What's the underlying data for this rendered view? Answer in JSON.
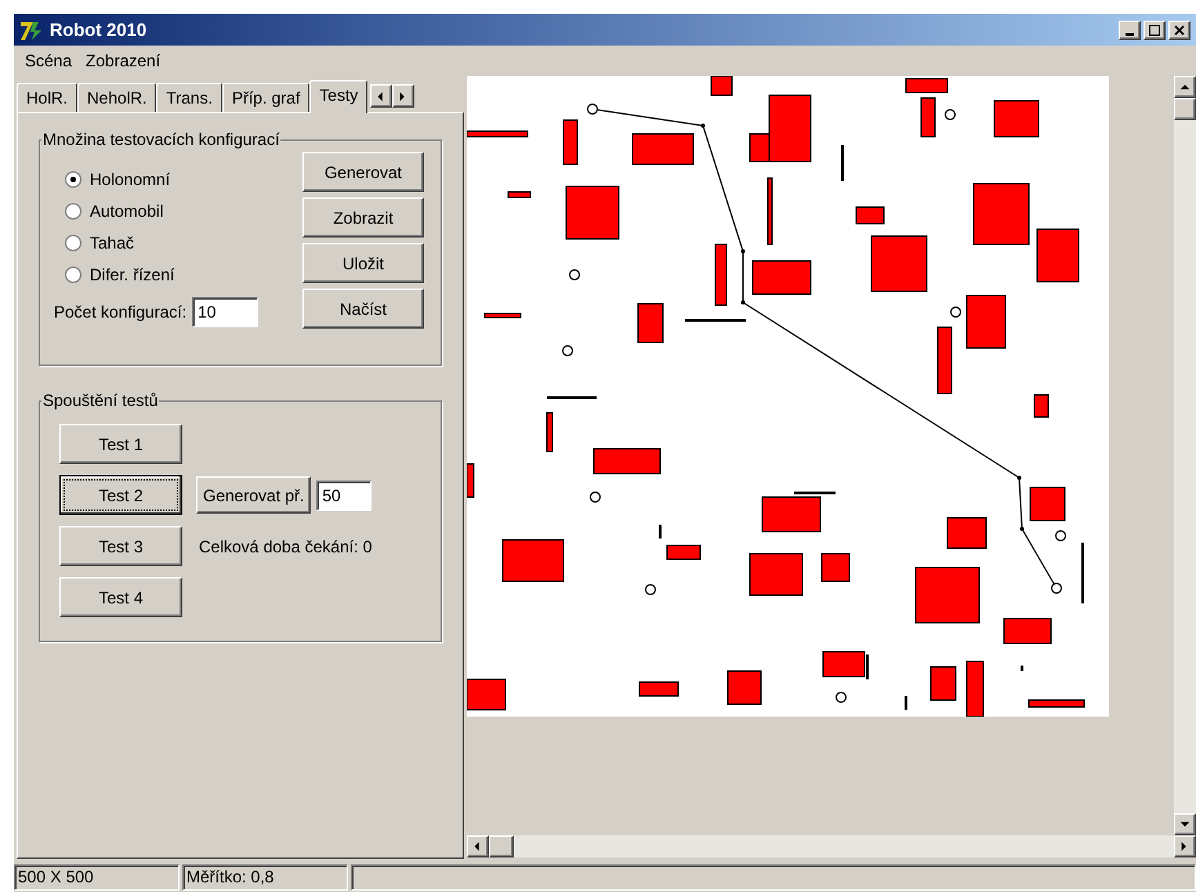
{
  "window": {
    "title": "Robot 2010"
  },
  "menu": [
    "Scéna",
    "Zobrazení"
  ],
  "tabs": [
    {
      "label": "HolR.",
      "selected": false
    },
    {
      "label": "NeholR.",
      "selected": false
    },
    {
      "label": "Trans.",
      "selected": false
    },
    {
      "label": "Příp. graf",
      "selected": false
    },
    {
      "label": "Testy",
      "selected": true
    }
  ],
  "config_group": {
    "title": "Množina testovacích konfigurací",
    "radios": [
      {
        "label": "Holonomní",
        "selected": true
      },
      {
        "label": "Automobil",
        "selected": false
      },
      {
        "label": "Tahač",
        "selected": false
      },
      {
        "label": "Difer. řízení",
        "selected": false
      }
    ],
    "count_label": "Počet konfigurací:",
    "count_value": "10",
    "buttons": [
      "Generovat",
      "Zobrazit",
      "Uložit",
      "Načíst"
    ]
  },
  "tests_group": {
    "title": "Spouštění testů",
    "tests": [
      {
        "label": "Test 1",
        "focused": false
      },
      {
        "label": "Test 2",
        "focused": true
      },
      {
        "label": "Test 3",
        "focused": false
      },
      {
        "label": "Test 4",
        "focused": false
      }
    ],
    "generate_button": "Generovat př.",
    "generate_value": "50",
    "waiting": "Celková doba čekání: 0"
  },
  "status_bar": [
    "500 X 500",
    "Měřítko: 0,8"
  ]
}
